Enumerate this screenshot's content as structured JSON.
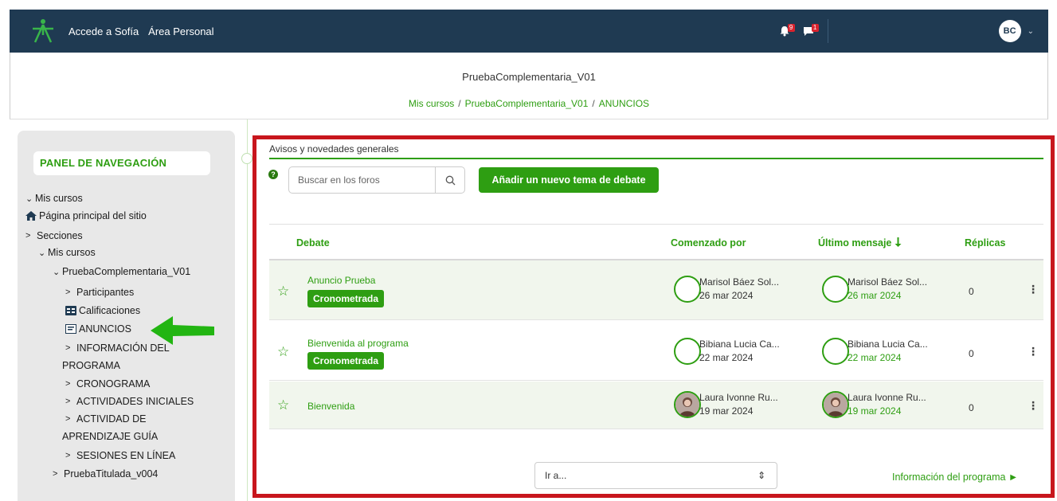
{
  "navbar": {
    "links": [
      "Accede a Sofía",
      "Área Personal"
    ],
    "notifications_count": "9",
    "messages_count": "1",
    "user_initials": "BC"
  },
  "header": {
    "course_title": "PruebaComplementaria_V01",
    "breadcrumb": [
      "Mis cursos",
      "PruebaComplementaria_V01",
      "ANUNCIOS"
    ]
  },
  "drawer": {
    "title": "PANEL DE NAVEGACIÓN",
    "items": [
      "Mis cursos",
      "Página principal del sitio",
      "Secciones",
      "Mis cursos",
      "PruebaComplementaria_V01",
      "Participantes",
      "Calificaciones",
      "ANUNCIOS",
      "INFORMACIÓN DEL",
      "PROGRAMA",
      "CRONOGRAMA",
      "ACTIVIDADES INICIALES",
      "ACTIVIDAD DE",
      "APRENDIZAJE GUÍA",
      "SESIONES EN LÍNEA",
      "PruebaTitulada_v004"
    ]
  },
  "forum": {
    "section_title": "Avisos y novedades generales",
    "search_placeholder": "Buscar en los foros",
    "add_button": "Añadir un nuevo tema de debate",
    "columns": {
      "debate": "Debate",
      "started_by": "Comenzado por",
      "last_post": "Último mensaje",
      "replies": "Réplicas"
    },
    "rows": [
      {
        "subject": "Anuncio Prueba",
        "tag": "Cronometrada",
        "author": "Marisol Báez Sol...",
        "author_date": "26 mar 2024",
        "last_author": "Marisol Báez Sol...",
        "last_date": "26 mar 2024",
        "replies": "0"
      },
      {
        "subject": "Bienvenida al programa",
        "tag": "Cronometrada",
        "author": "Bibiana Lucia Ca...",
        "author_date": "22 mar 2024",
        "last_author": "Bibiana Lucia Ca...",
        "last_date": "22 mar 2024",
        "replies": "0"
      },
      {
        "subject": "Bienvenida",
        "tag": "",
        "author": "Laura Ivonne Ru...",
        "author_date": "19 mar 2024",
        "last_author": "Laura Ivonne Ru...",
        "last_date": "19 mar 2024",
        "replies": "0"
      }
    ],
    "jump_to": "Ir a...",
    "next_activity": "Información del programa ►"
  },
  "colors": {
    "navbar": "#1f3a52",
    "accent_green": "#2e9e12",
    "frame_red": "#c8161d",
    "drawer_bg": "#e8e8e8"
  }
}
